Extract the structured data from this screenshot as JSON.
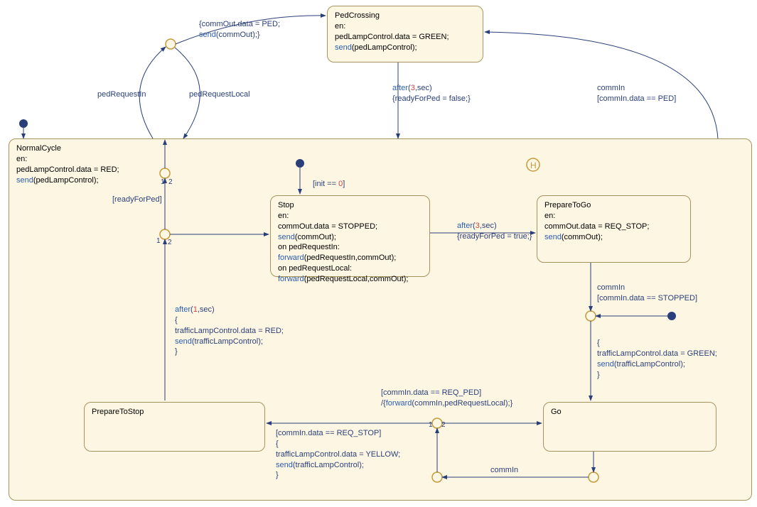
{
  "states": {
    "pedCrossing": {
      "title": "PedCrossing",
      "body": "en:\npedLampControl.data = GREEN;\nsend(pedLampControl);"
    },
    "normalCycle": {
      "title": "NormalCycle",
      "body": "en:\npedLampControl.data = RED;\nsend(pedLampControl);"
    },
    "stop": {
      "title": "Stop",
      "body": "en:\ncommOut.data = STOPPED;\nsend(commOut);\non pedRequestIn:\nforward(pedRequestIn,commOut);\non pedRequestLocal:\nforward(pedRequestLocal,commOut);"
    },
    "prepareToGo": {
      "title": "PrepareToGo",
      "body": "en:\ncommOut.data = REQ_STOP;\nsend(commOut);"
    },
    "prepareToStop": {
      "title": "PrepareToStop",
      "body": ""
    },
    "go": {
      "title": "Go",
      "body": ""
    }
  },
  "labels": {
    "topTrans": "{commOut.data = PED;\nsend(commOut);}",
    "pedRequestIn": "pedRequestIn",
    "pedRequestLocal": "pedRequestLocal",
    "afterPed": "after(3,sec)\n{readyForPed = false;}",
    "commInPed": "commIn\n[commIn.data == PED]",
    "initCond": "[init == 0]",
    "readyForPed": "[readyForPed]",
    "afterStop": "after(3,sec)\n{readyForPed = true;}",
    "commInStopped": "commIn\n[commIn.data == STOPPED]",
    "greenAction": "{\ntrafficLampControl.data = GREEN;\nsend(trafficLampControl);\n}",
    "afterPrepStop": "after(1,sec)\n{\ntrafficLampControl.data = RED;\nsend(trafficLampControl);\n}",
    "reqPed": "[commIn.data == REQ_PED]\n/{forward(commIn,pedRequestLocal);}",
    "reqStop": "[commIn.data == REQ_STOP]\n{\ntrafficLampControl.data = YELLOW;\nsend(trafficLampControl);\n}",
    "commIn": "commIn"
  },
  "chart_data": {
    "type": "statechart",
    "top_level_states": [
      "PedCrossing",
      "NormalCycle"
    ],
    "substates_of_NormalCycle": [
      "Stop",
      "PrepareToGo",
      "Go",
      "PrepareToStop"
    ],
    "default_transition_to": "NormalCycle",
    "history_in": "NormalCycle",
    "transitions": [
      {
        "from": "(junction near NormalCycle top)",
        "to": "PedCrossing",
        "guard_action": "{commOut.data = PED; send(commOut);}"
      },
      {
        "from": "PedCrossing",
        "to": "NormalCycle",
        "trigger": "after(3,sec)",
        "action": "{readyForPed = false;}"
      },
      {
        "from": "(NormalCycle inner junction)",
        "to": "(top junction)",
        "priority": 1,
        "guard": "[readyForPed]"
      },
      {
        "from": "(NormalCycle inner junction)",
        "to": "Stop",
        "priority": 2
      },
      {
        "from": "NormalCycle (boundary)",
        "to": "(top junction)",
        "event": "pedRequestIn"
      },
      {
        "from": "(top junction)",
        "to": "NormalCycle (boundary)",
        "event": "pedRequestLocal"
      },
      {
        "from": "(initial inside NormalCycle)",
        "to": "Stop",
        "guard": "[init == 0]"
      },
      {
        "from": "Stop",
        "to": "PrepareToGo",
        "trigger": "after(3,sec)",
        "action": "{readyForPed = true;}"
      },
      {
        "from": "PrepareToGo",
        "to": "(junction)",
        "event": "commIn",
        "guard": "[commIn.data == STOPPED]"
      },
      {
        "from": "(initial near PrepareToGo)",
        "to": "(junction)"
      },
      {
        "from": "(junction)",
        "to": "Go",
        "action": "{trafficLampControl.data = GREEN; send(trafficLampControl);}"
      },
      {
        "from": "Go",
        "to": "(junction-go)",
        "event": "commIn"
      },
      {
        "from": "(junction-go)",
        "to": "(junction-mid)"
      },
      {
        "from": "(junction-mid)",
        "to": "Go",
        "priority": 2,
        "guard": "[commIn.data == REQ_PED]",
        "action": "/{forward(commIn,pedRequestLocal);}"
      },
      {
        "from": "(junction-mid)",
        "to": "PrepareToStop",
        "priority": 1,
        "guard": "[commIn.data == REQ_STOP]",
        "action": "{trafficLampControl.data = YELLOW; send(trafficLampControl);}"
      },
      {
        "from": "PrepareToStop",
        "to": "(NormalCycle inner junction)",
        "trigger": "after(1,sec)",
        "action": "{trafficLampControl.data = RED; send(trafficLampControl);}"
      },
      {
        "from": "(outer junction)",
        "to": "PedCrossing",
        "event": "commIn",
        "guard": "[commIn.data == PED]"
      }
    ]
  }
}
